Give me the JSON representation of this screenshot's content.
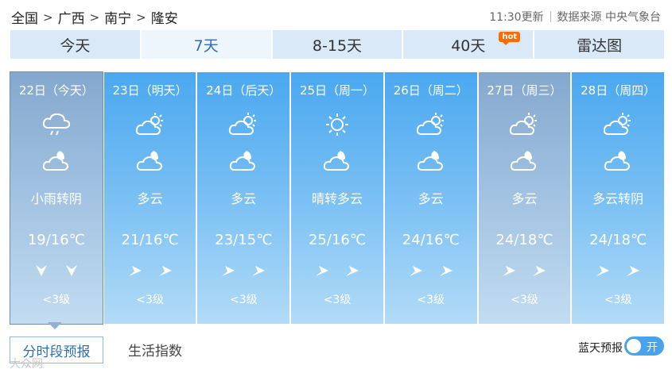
{
  "breadcrumb": [
    "全国",
    "广西",
    "南宁",
    "隆安"
  ],
  "separator": ">",
  "meta": {
    "update_time": "11:30更新",
    "source": "数据来源 中央气象台"
  },
  "tabs": [
    {
      "label": "今天"
    },
    {
      "label": "7天",
      "active": true
    },
    {
      "label": "8-15天"
    },
    {
      "label": "40天",
      "badge": "hot"
    },
    {
      "label": "雷达图"
    }
  ],
  "days": [
    {
      "title": "22日（今天）",
      "weather": "小雨转阴",
      "temp": "19/16℃",
      "wind_level": "<3级",
      "icon_day": "rain-icon",
      "icon_night": "cloudy-night-icon",
      "wind_icon": "wind-north-icon"
    },
    {
      "title": "23日（明天）",
      "weather": "多云",
      "temp": "21/16℃",
      "wind_level": "<3级",
      "icon_day": "partly-cloudy-icon",
      "icon_night": "cloudy-night-icon",
      "wind_icon": "wind-east-icon"
    },
    {
      "title": "24日（后天）",
      "weather": "多云",
      "temp": "23/15℃",
      "wind_level": "<3级",
      "icon_day": "partly-cloudy-icon",
      "icon_night": "cloudy-night-icon",
      "wind_icon": "wind-east-icon"
    },
    {
      "title": "25日（周一）",
      "weather": "晴转多云",
      "temp": "25/16℃",
      "wind_level": "<3级",
      "icon_day": "sun-icon",
      "icon_night": "cloudy-night-icon",
      "wind_icon": "wind-east-icon"
    },
    {
      "title": "26日（周二）",
      "weather": "多云",
      "temp": "24/16℃",
      "wind_level": "<3级",
      "icon_day": "partly-cloudy-icon",
      "icon_night": "cloudy-night-icon",
      "wind_icon": "wind-east-icon"
    },
    {
      "title": "27日（周三）",
      "weather": "多云",
      "temp": "24/18℃",
      "wind_level": "<3级",
      "icon_day": "partly-cloudy-icon",
      "icon_night": "cloudy-night-icon",
      "wind_icon": "wind-east-icon"
    },
    {
      "title": "28日（周四）",
      "weather": "多云转阴",
      "temp": "24/18℃",
      "wind_level": "<3级",
      "icon_day": "partly-cloudy-icon",
      "icon_night": "cloudy-night-icon",
      "wind_icon": "wind-east-icon"
    }
  ],
  "bottom": {
    "tabs": [
      "分时段预报",
      "生活指数"
    ],
    "blue_sky_label": "蓝天预报",
    "toggle_label": "开",
    "watermark": "大众网"
  },
  "colors": {
    "accent": "#2f6fb0",
    "day_card_top": "#4aa8f0",
    "rain_card_top": "#84a8cd",
    "toggle": "#4aa2ea",
    "hot_badge": "#ff6a00"
  }
}
